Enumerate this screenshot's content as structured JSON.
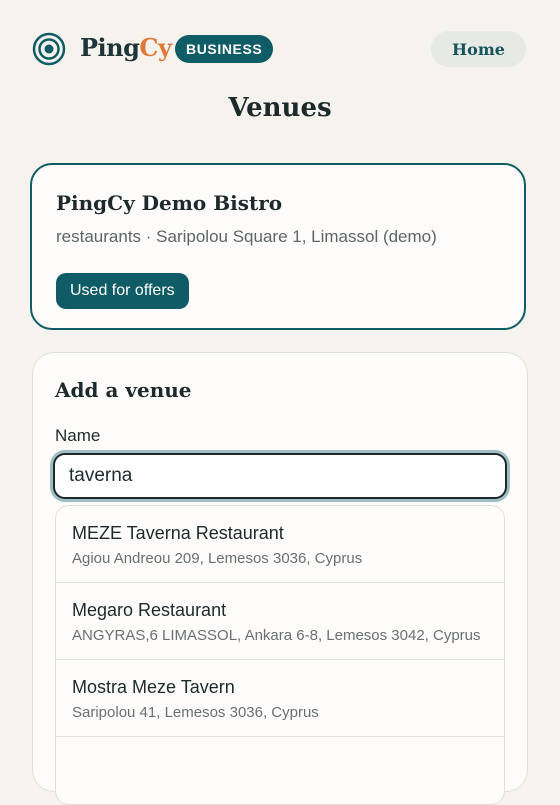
{
  "header": {
    "brand_main": "Ping",
    "brand_accent": "Cy",
    "badge": "BUSINESS",
    "home_label": "Home",
    "logo_icon": "target-rings-icon"
  },
  "page": {
    "title": "Venues"
  },
  "venue": {
    "name": "PingCy Demo Bistro",
    "meta": "restaurants · Saripolou Square 1, Limassol (demo)",
    "badge": "Used for offers"
  },
  "add_venue": {
    "title": "Add a venue",
    "name_label": "Name",
    "search_value": "taverna"
  },
  "suggestions": [
    {
      "name": "MEZE Taverna Restaurant",
      "address": "Agiou Andreou 209, Lemesos 3036, Cyprus"
    },
    {
      "name": "Megaro Restaurant",
      "address": "ANGYRAS,6 LIMASSOL, Ankara 6-8, Lemesos 3042, Cyprus"
    },
    {
      "name": "Mostra Meze Tavern",
      "address": "Saripolou 41, Lemesos 3036, Cyprus"
    }
  ],
  "colors": {
    "brand_teal": "#0f5c66",
    "accent_orange": "#e07a3a",
    "background": "#f6f3ee"
  }
}
